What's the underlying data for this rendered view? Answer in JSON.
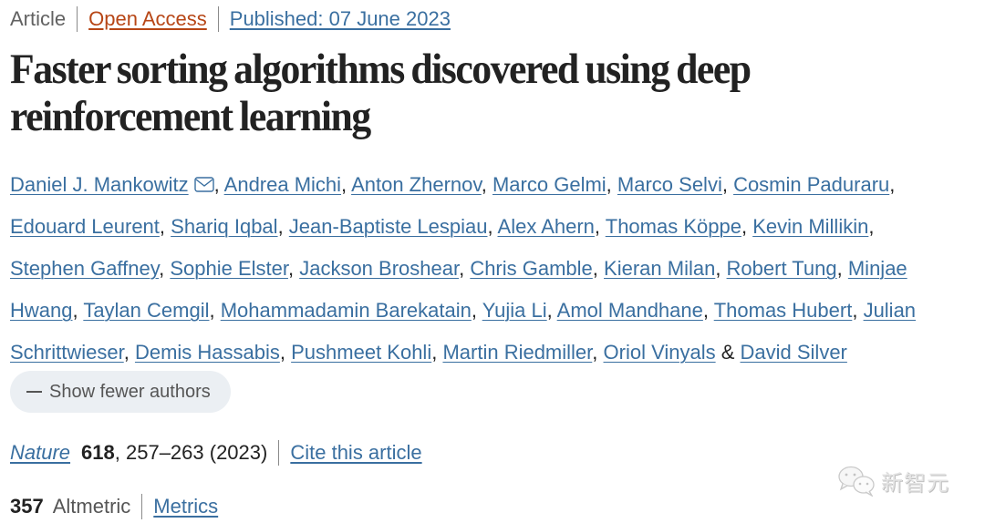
{
  "meta": {
    "article_type": "Article",
    "open_access_label": "Open Access",
    "published_label": "Published: 07 June 2023"
  },
  "title": {
    "line1": "Faster sorting algorithms discovered using deep",
    "line2": "reinforcement learning"
  },
  "authors": {
    "lines": [
      [
        "Daniel J. Mankowitz",
        "Andrea Michi",
        "Anton Zhernov",
        "Marco Gelmi",
        "Marco Selvi",
        "Cosmin Paduraru"
      ],
      [
        "Edouard Leurent",
        "Shariq Iqbal",
        "Jean-Baptiste Lespiau",
        "Alex Ahern",
        "Thomas Köppe",
        "Kevin Millikin"
      ],
      [
        "Stephen Gaffney",
        "Sophie Elster",
        "Jackson Broshear",
        "Chris Gamble",
        "Kieran Milan",
        "Robert Tung",
        "Minjae"
      ],
      [
        "Hwang",
        "Taylan Cemgil",
        "Mohammadamin Barekatain",
        "Yujia Li",
        "Amol Mandhane",
        "Thomas Hubert",
        "Julian"
      ],
      [
        "Schrittwieser",
        "Demis Hassabis",
        "Pushmeet Kohli",
        "Martin Riedmiller",
        "Oriol Vinyals",
        "David Silver"
      ]
    ],
    "separator": ", ",
    "last_conjunction": " & ",
    "corresponding_icon": "envelope-icon",
    "toggle_label": "Show fewer authors"
  },
  "citation": {
    "journal": "Nature",
    "volume": "618",
    "pages_year": ", 257–263 (2023)",
    "cite_label": "Cite this article"
  },
  "metrics": {
    "altmetric_score": "357",
    "altmetric_label": "Altmetric",
    "metrics_label": "Metrics"
  },
  "watermark": {
    "text": "新智元",
    "icon": "wechat-icon"
  },
  "colors": {
    "link": "#3a6fa0",
    "open_access": "#b74616",
    "text": "#222222",
    "muted": "#626262",
    "button_bg": "#ebeff3"
  }
}
